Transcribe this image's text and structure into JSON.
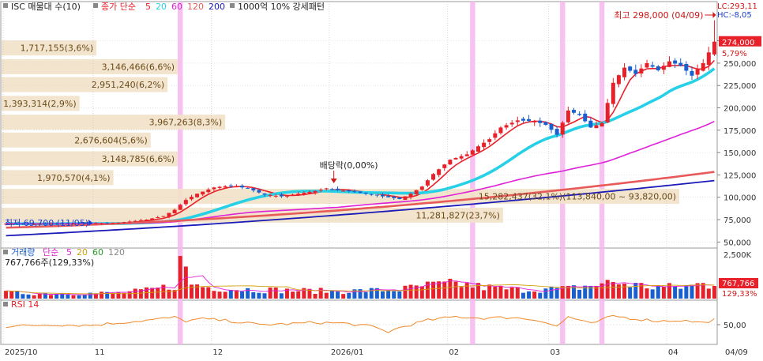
{
  "header": {
    "title": "ISC 매물대 수(10)",
    "ma_prefix": "종가 단순",
    "ma_periods": [
      {
        "label": "5",
        "color": "#e8202a"
      },
      {
        "label": "20",
        "color": "#26d0e6"
      },
      {
        "label": "60",
        "color": "#e020d8"
      },
      {
        "label": "120",
        "color": "#e85a5a"
      },
      {
        "label": "200",
        "color": "#1a1ab8"
      }
    ],
    "pattern": "1000억 10% 강세패턴"
  },
  "price_panel": {
    "lc_label": "LC:293,11",
    "hc_label": "HC:-8,05",
    "high_annotation": "최고 298,000 (04/09)",
    "low_annotation": "최저 69,700 (11/05)",
    "dividend_annotation": "배당락(0,00%)",
    "current_price_label": "274,000",
    "current_change_label": "5,79%",
    "y_ticks": [
      "275,000",
      "250,000",
      "225,000",
      "200,000",
      "175,000",
      "150,000",
      "125,000",
      "100,000",
      "75,000",
      "50,000"
    ]
  },
  "volume_profile": [
    {
      "label": "1,717,155(3,6%)",
      "price": 267000,
      "width": 0.14
    },
    {
      "label": "3,146,466(6,6%)",
      "price": 246000,
      "width": 0.26
    },
    {
      "label": "2,951,240(6,2%)",
      "price": 226000,
      "width": 0.245
    },
    {
      "label": "1,393,314(2,9%)",
      "price": 205000,
      "width": 0.115
    },
    {
      "label": "3,967,263(8,3%)",
      "price": 184000,
      "width": 0.33
    },
    {
      "label": "2,676,604(5,6%)",
      "price": 164000,
      "width": 0.22
    },
    {
      "label": "3,148,785(6,6%)",
      "price": 143000,
      "width": 0.26
    },
    {
      "label": "1,970,570(4,1%)",
      "price": 122000,
      "width": 0.165
    },
    {
      "label": "15,282,437(32,1%)(113,840,00 ~ 93,820,00)",
      "price": 101000,
      "width": 1.0
    },
    {
      "label": "11,281,827(23,7%)",
      "price": 80000,
      "width": 0.74
    }
  ],
  "volume_panel": {
    "title": "거래량",
    "ma_prefix": "단순",
    "ma_periods": [
      {
        "label": "5",
        "color": "#e020d8"
      },
      {
        "label": "20",
        "color": "#d4a010"
      },
      {
        "label": "60",
        "color": "#2a9a2a"
      },
      {
        "label": "120",
        "color": "#888888"
      }
    ],
    "current_label": "767,766주(129,33%)",
    "axis_label": "2,500K",
    "current_value_label": "767,766",
    "current_pct_label": "129,33%"
  },
  "rsi_panel": {
    "title": "RSI 14",
    "axis_label": "50,00"
  },
  "x_axis": {
    "labels": [
      {
        "text": "2025/10",
        "index": 0
      },
      {
        "text": "11",
        "index": 16
      },
      {
        "text": "12",
        "index": 37
      },
      {
        "text": "2026/01",
        "index": 58
      },
      {
        "text": "02",
        "index": 79
      },
      {
        "text": "03",
        "index": 97
      },
      {
        "text": "04",
        "index": 118
      }
    ],
    "end_label": "04/09"
  },
  "colors": {
    "up": "#e8202a",
    "down": "#1a5fd0",
    "highlight": "#f6b6f0",
    "profile": "#f2e2c8",
    "profile_text": "#6b4a1a"
  },
  "highlight_indices": [
    31,
    83,
    99,
    106
  ],
  "chart_data": {
    "type": "candlestick",
    "title": "ISC",
    "bars": 127,
    "x_start": "2025/10",
    "x_end": "04/09",
    "ylim": [
      45000,
      310000
    ],
    "anchor_close": [
      [
        0,
        70500
      ],
      [
        5,
        70000
      ],
      [
        10,
        71000
      ],
      [
        15,
        70500
      ],
      [
        20,
        71500
      ],
      [
        25,
        75000
      ],
      [
        28,
        79000
      ],
      [
        30,
        86000
      ],
      [
        32,
        97000
      ],
      [
        34,
        104000
      ],
      [
        37,
        111000
      ],
      [
        40,
        113000
      ],
      [
        43,
        110000
      ],
      [
        46,
        103000
      ],
      [
        49,
        101000
      ],
      [
        52,
        104000
      ],
      [
        55,
        107000
      ],
      [
        57,
        110000
      ],
      [
        59,
        108000
      ],
      [
        62,
        106000
      ],
      [
        65,
        103000
      ],
      [
        68,
        100000
      ],
      [
        70,
        98000
      ],
      [
        72,
        104000
      ],
      [
        74,
        112000
      ],
      [
        76,
        126000
      ],
      [
        79,
        142000
      ],
      [
        82,
        148000
      ],
      [
        84,
        157000
      ],
      [
        86,
        165000
      ],
      [
        88,
        178000
      ],
      [
        91,
        186000
      ],
      [
        94,
        185000
      ],
      [
        96,
        181000
      ],
      [
        98,
        170000
      ],
      [
        100,
        197000
      ],
      [
        102,
        192000
      ],
      [
        104,
        178000
      ],
      [
        106,
        183000
      ],
      [
        108,
        228000
      ],
      [
        110,
        245000
      ],
      [
        112,
        238000
      ],
      [
        114,
        250000
      ],
      [
        116,
        242000
      ],
      [
        118,
        252000
      ],
      [
        120,
        247000
      ],
      [
        122,
        236000
      ],
      [
        124,
        250000
      ],
      [
        126,
        274000
      ]
    ],
    "volume_anchor": [
      [
        0,
        0.35
      ],
      [
        10,
        0.3
      ],
      [
        20,
        0.35
      ],
      [
        25,
        0.5
      ],
      [
        30,
        0.8
      ],
      [
        31,
        2.6
      ],
      [
        33,
        0.9
      ],
      [
        36,
        0.7
      ],
      [
        40,
        0.6
      ],
      [
        50,
        0.5
      ],
      [
        60,
        0.45
      ],
      [
        70,
        0.55
      ],
      [
        75,
        0.8
      ],
      [
        80,
        0.9
      ],
      [
        85,
        0.7
      ],
      [
        90,
        0.55
      ],
      [
        100,
        0.6
      ],
      [
        108,
        1.0
      ],
      [
        115,
        0.7
      ],
      [
        120,
        0.7
      ],
      [
        124,
        0.9
      ],
      [
        126,
        0.77
      ]
    ],
    "rsi_anchor": [
      [
        0,
        45
      ],
      [
        8,
        50
      ],
      [
        15,
        48
      ],
      [
        20,
        55
      ],
      [
        25,
        62
      ],
      [
        30,
        70
      ],
      [
        32,
        60
      ],
      [
        35,
        66
      ],
      [
        40,
        60
      ],
      [
        45,
        50
      ],
      [
        50,
        52
      ],
      [
        55,
        56
      ],
      [
        60,
        54
      ],
      [
        65,
        45
      ],
      [
        68,
        30
      ],
      [
        70,
        42
      ],
      [
        75,
        62
      ],
      [
        80,
        72
      ],
      [
        85,
        68
      ],
      [
        90,
        70
      ],
      [
        95,
        62
      ],
      [
        98,
        45
      ],
      [
        100,
        72
      ],
      [
        104,
        52
      ],
      [
        108,
        74
      ],
      [
        112,
        66
      ],
      [
        116,
        60
      ],
      [
        120,
        62
      ],
      [
        124,
        55
      ],
      [
        126,
        64
      ]
    ],
    "volume_max_k": 2700,
    "rsi_ylim": [
      0,
      100
    ]
  }
}
